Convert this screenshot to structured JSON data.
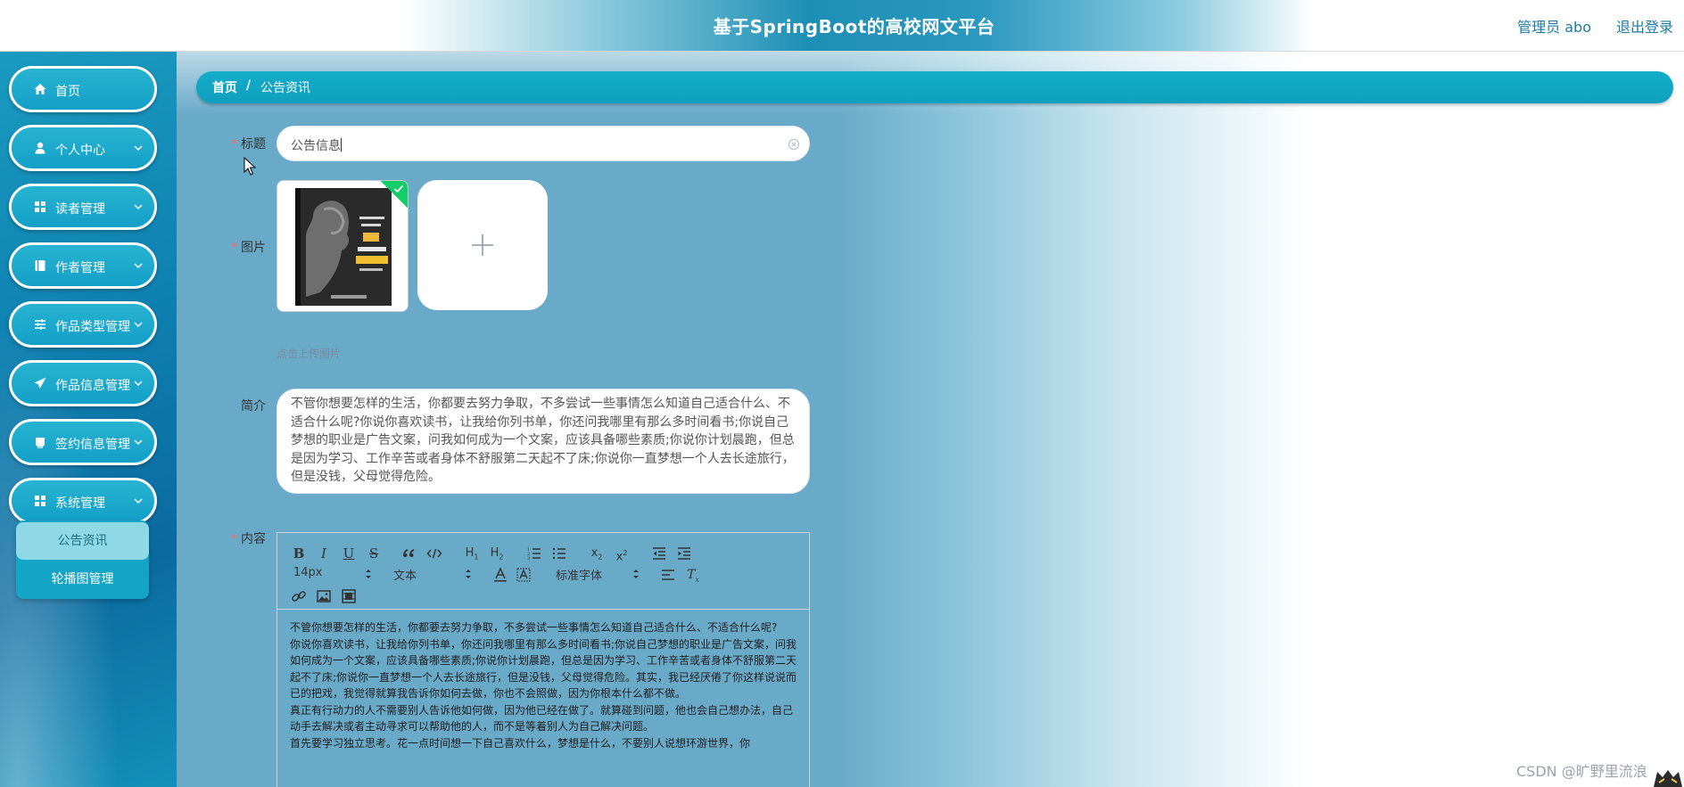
{
  "header": {
    "title": "基于SpringBoot的高校网文平台",
    "user": "管理员 abo",
    "logout": "退出登录"
  },
  "sidebar": {
    "items": [
      {
        "label": "首页",
        "icon": "home-icon",
        "expandable": false
      },
      {
        "label": "个人中心",
        "icon": "user-icon",
        "expandable": true
      },
      {
        "label": "读者管理",
        "icon": "grid-icon",
        "expandable": true
      },
      {
        "label": "作者管理",
        "icon": "book-icon",
        "expandable": true
      },
      {
        "label": "作品类型管理",
        "icon": "sliders-icon",
        "expandable": true
      },
      {
        "label": "作品信息管理",
        "icon": "send-icon",
        "expandable": true
      },
      {
        "label": "签约信息管理",
        "icon": "cup-icon",
        "expandable": true
      },
      {
        "label": "系统管理",
        "icon": "grid-icon",
        "expandable": true
      }
    ],
    "submenu": [
      {
        "label": "公告资讯",
        "active": true
      },
      {
        "label": "轮播图管理",
        "active": false
      }
    ]
  },
  "breadcrumb": {
    "home": "首页",
    "separator": "/",
    "current": "公告资讯"
  },
  "form": {
    "title_label": "标题",
    "title_value": "公告信息",
    "image_label": "图片",
    "image_tip": "点击上传图片",
    "intro_label": "简介",
    "intro_value": "不管你想要怎样的生活，你都要去努力争取，不多尝试一些事情怎么知道自己适合什么、不适合什么呢?你说你喜欢读书，让我给你列书单，你还问我哪里有那么多时间看书;你说自己梦想的职业是广告文案，问我如何成为一个文案，应该具备哪些素质;你说你计划晨跑，但总是因为学习、工作辛苦或者身体不舒服第二天起不了床;你说你一直梦想一个人去长途旅行，但是没钱，父母觉得危险。",
    "content_label": "内容",
    "required_mark": "*"
  },
  "editor": {
    "toolbar": {
      "font_size": "14px",
      "paragraph": "文本",
      "font_family": "标准字体",
      "buttons": [
        "bold",
        "italic",
        "underline",
        "strike",
        "blockquote",
        "code-block",
        "header-1",
        "header-2",
        "ordered-list",
        "bullet-list",
        "subscript",
        "superscript",
        "outdent",
        "indent",
        "font-color",
        "background-color",
        "align",
        "clean",
        "link",
        "image",
        "video"
      ]
    },
    "content": [
      "不管你想要怎样的生活，你都要去努力争取，不多尝试一些事情怎么知道自己适合什么、不适合什么呢?",
      "你说你喜欢读书，让我给你列书单，你还问我哪里有那么多时间看书;你说自己梦想的职业是广告文案，问我如何成为一个文案，应该具备哪些素质;你说你计划晨跑，但总是因为学习、工作辛苦或者身体不舒服第二天起不了床;你说你一直梦想一个人去长途旅行，但是没钱，父母觉得危险。其实，我已经厌倦了你这样说说而已的把戏，我觉得就算我告诉你如何去做，你也不会照做，因为你根本什么都不做。",
      "真正有行动力的人不需要别人告诉他如何做，因为他已经在做了。就算碰到问题，他也会自己想办法，自己动手去解决或者主动寻求可以帮助他的人，而不是等着别人为自己解决问题。",
      "首先要学习独立思考。花一点时间想一下自己喜欢什么，梦想是什么，不要别人说想环游世界，你"
    ]
  },
  "watermark": "CSDN @旷野里流浪",
  "colors": {
    "accent": "#13a4c6",
    "sidebar_bg": "#0e7fb0",
    "required": "#f56c6c",
    "success": "#13ce66",
    "link": "#1d7aa6"
  }
}
